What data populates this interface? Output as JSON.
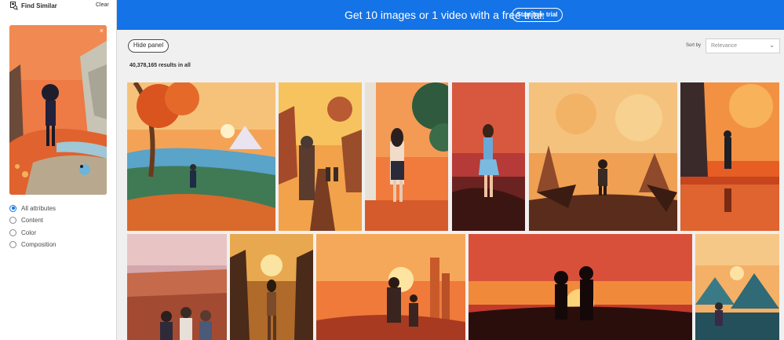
{
  "sidebar": {
    "title": "Find Similar",
    "clear": "Clear",
    "close_symbol": "×",
    "options": [
      "All attributes",
      "Content",
      "Color",
      "Composition"
    ],
    "selected": "All attributes"
  },
  "banner": {
    "text": "Get 10 images or 1 video with a free trial.",
    "button": "Start free trial",
    "color": "#1473e6"
  },
  "toolbar": {
    "hide_panel": "Hide panel",
    "results": "40,378,165 results in all",
    "sort_label": "Sort by",
    "sort_value": "Relevance"
  },
  "icons": {
    "find_similar": "find-similar-icon",
    "close": "close-icon",
    "sort_chevron": "chevron-down-icon"
  }
}
